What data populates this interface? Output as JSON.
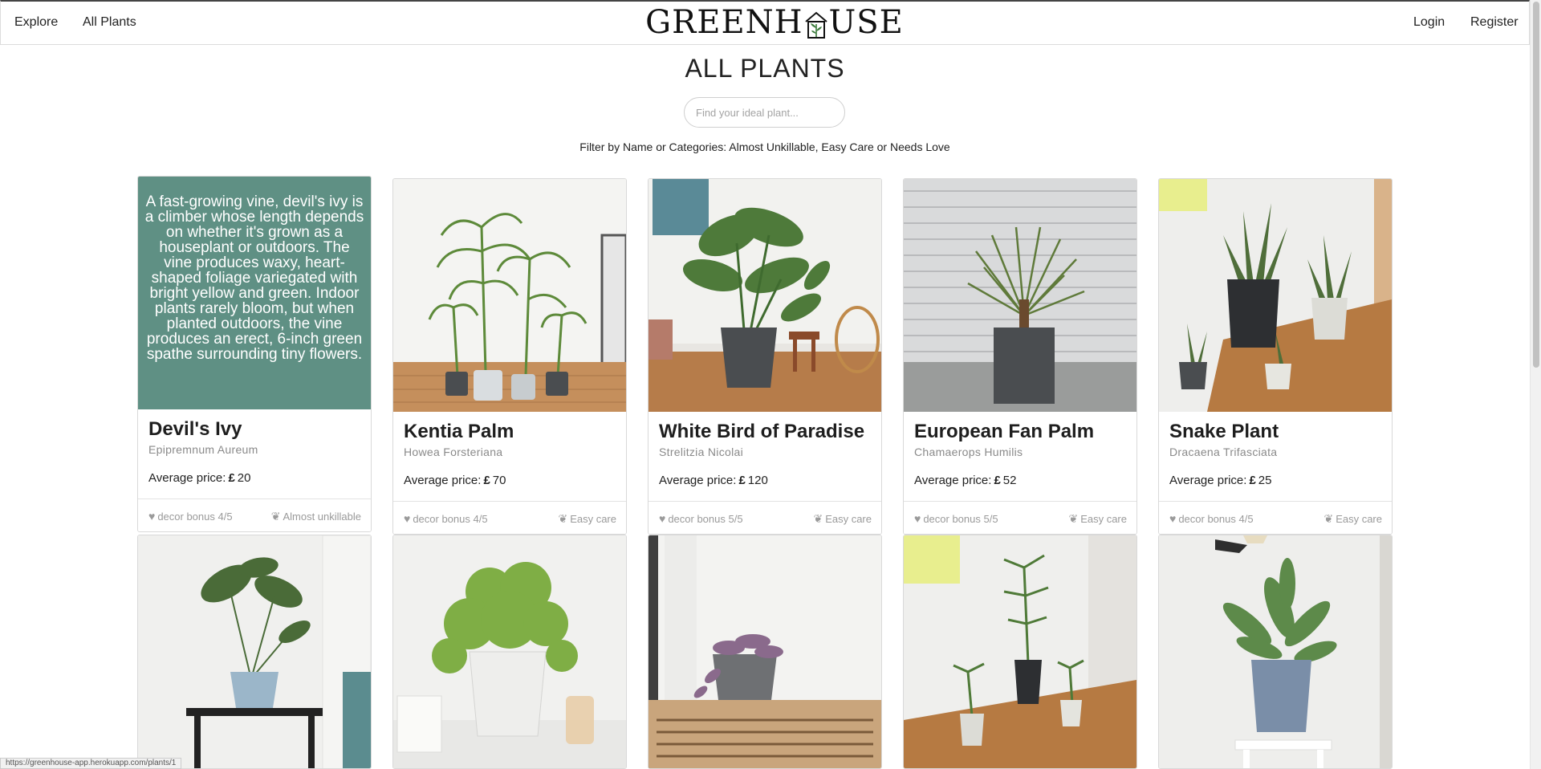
{
  "nav": {
    "explore": "Explore",
    "all_plants": "All Plants",
    "login": "Login",
    "register": "Register",
    "logo_left": "GREENH",
    "logo_right": "USE"
  },
  "page": {
    "title": "ALL PLANTS",
    "search_placeholder": "Find your ideal plant...",
    "filter_text": "Filter by Name or Categories: Almost Unkillable, Easy Care or Needs Love"
  },
  "cards": [
    {
      "name": "Devil's Ivy",
      "scientific": "Epipremnum Aureum",
      "price_label": "Average price:",
      "currency": "£",
      "price": "20",
      "decor": "decor bonus 4/5",
      "care": "Almost unkillable",
      "description": "A fast-growing vine, devil's ivy is a climber whose length depends on whether it's grown as a houseplant or outdoors. The vine produces waxy, heart-shaped foliage variegated with bright yellow and green. Indoor plants rarely bloom, but when planted outdoors, the vine produces an erect, 6-inch green spathe surrounding tiny flowers."
    },
    {
      "name": "Kentia Palm",
      "scientific": "Howea Forsteriana",
      "price_label": "Average price:",
      "currency": "£",
      "price": "70",
      "decor": "decor bonus 4/5",
      "care": "Easy care"
    },
    {
      "name": "White Bird of Paradise",
      "scientific": "Strelitzia Nicolai",
      "price_label": "Average price:",
      "currency": "£",
      "price": "120",
      "decor": "decor bonus 5/5",
      "care": "Easy care"
    },
    {
      "name": "European Fan Palm",
      "scientific": "Chamaerops Humilis",
      "price_label": "Average price:",
      "currency": "£",
      "price": "52",
      "decor": "decor bonus 5/5",
      "care": "Easy care"
    },
    {
      "name": "Snake Plant",
      "scientific": "Dracaena Trifasciata",
      "price_label": "Average price:",
      "currency": "£",
      "price": "25",
      "decor": "decor bonus 4/5",
      "care": "Easy care"
    }
  ],
  "images": {
    "wall": "#f3f3f1",
    "floor_wood": "#b98252",
    "pot_dark": "#4a4d50",
    "leaf": "#4f7a38",
    "leaf_light": "#7aa84a"
  },
  "status_url": "https://greenhouse-app.herokuapp.com/plants/1"
}
